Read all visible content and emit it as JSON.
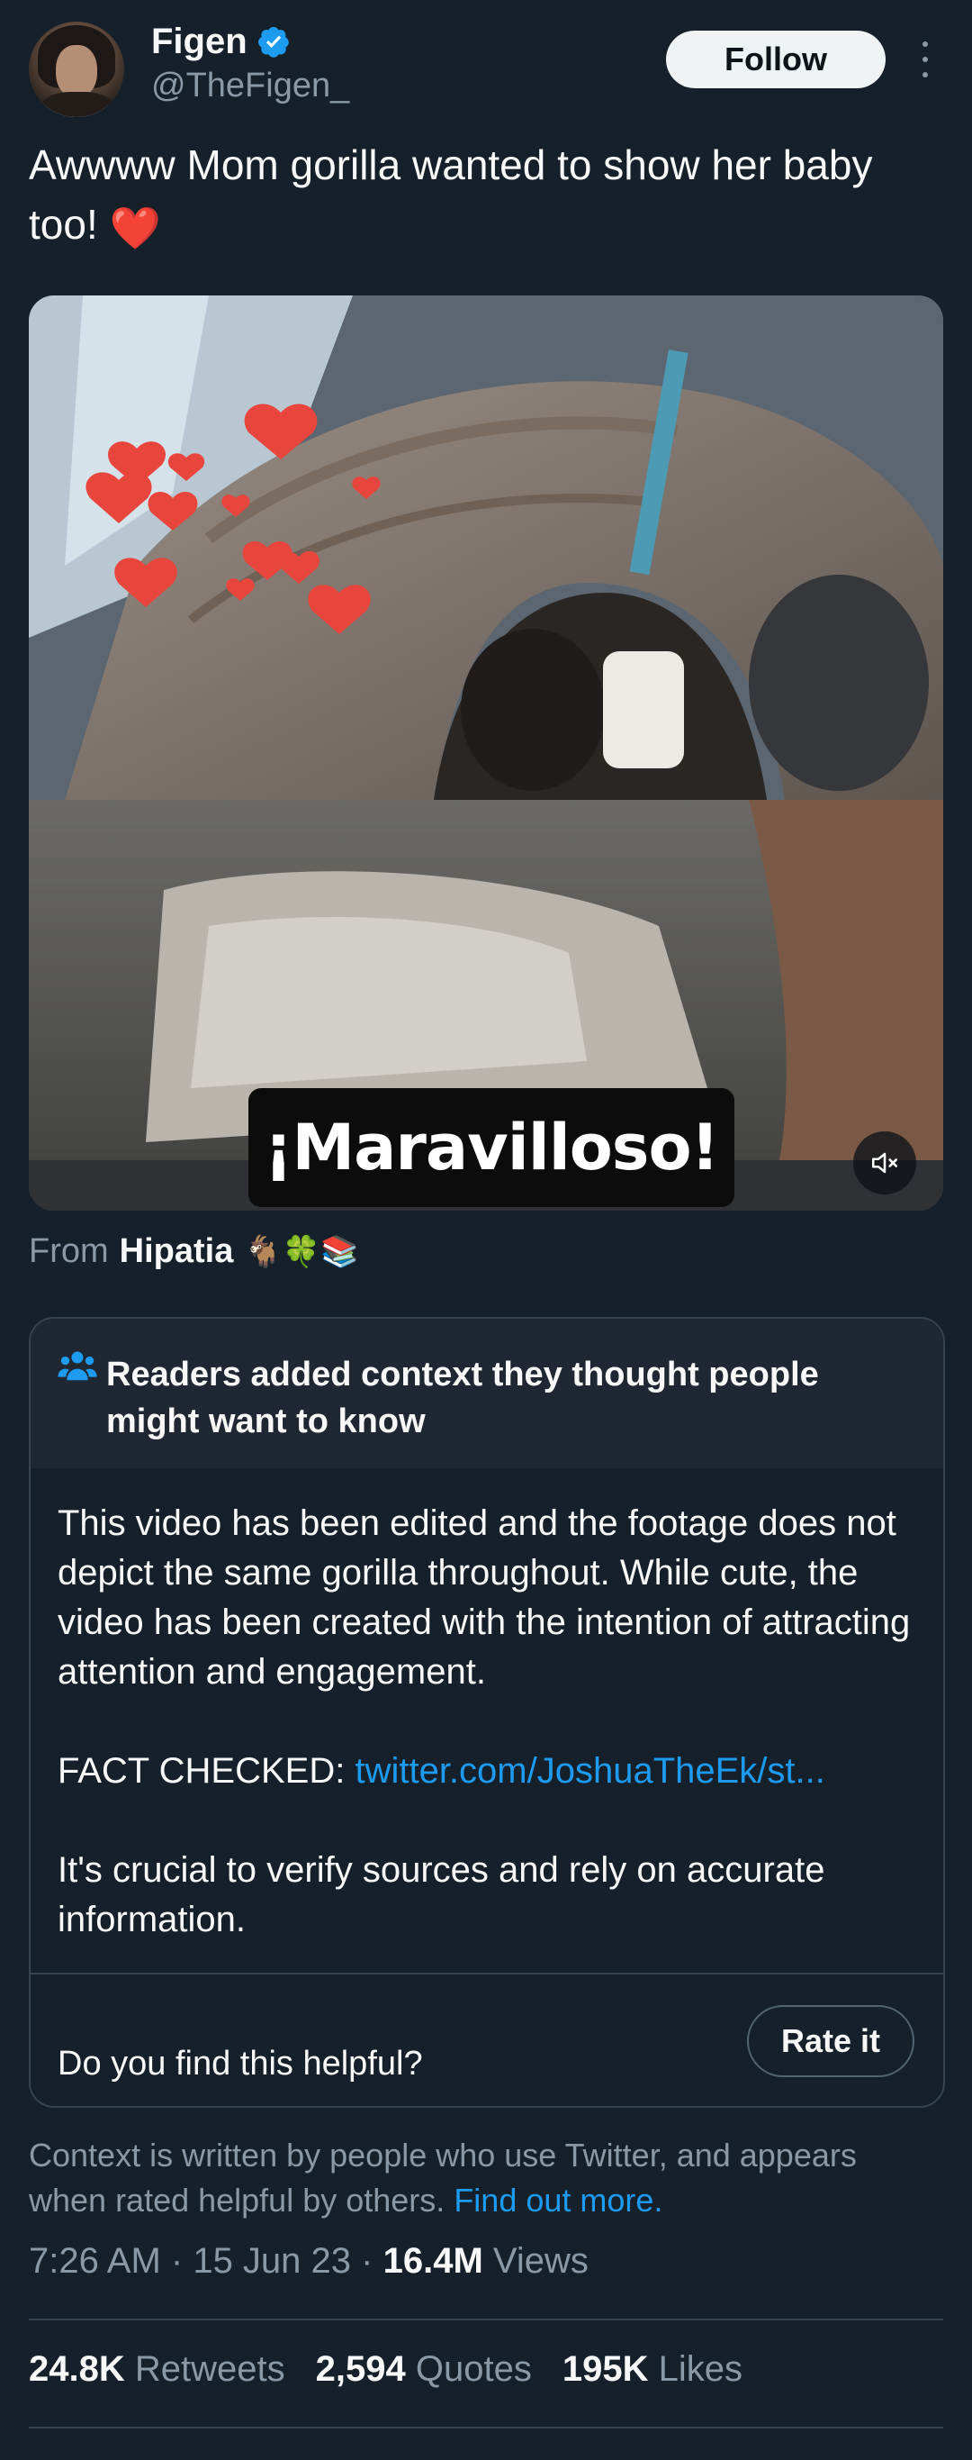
{
  "author": {
    "name": "Figen",
    "handle": "@TheFigen_",
    "verified_color": "#1d9bf0"
  },
  "header": {
    "follow_label": "Follow"
  },
  "tweet": {
    "text": "Awwww Mom gorilla wanted to show her baby too!",
    "emoji": "❤️"
  },
  "media": {
    "caption": "¡Maravilloso!",
    "mute_icon": "speaker-muted-icon"
  },
  "source": {
    "prefix": "From",
    "name": "Hipatia",
    "emojis": "🐐🍀📚"
  },
  "community_note": {
    "title": "Readers added context they thought people might want to know",
    "paragraph_1": "This video has been edited and the footage does not depict the same gorilla throughout. While cute, the video has been created with the intention of attracting attention and engagement.",
    "fact_checked_label": "FACT CHECKED:",
    "fact_checked_link": "twitter.com/JoshuaTheEk/st...",
    "paragraph_3": "It's crucial to verify sources and rely on accurate information.",
    "helpful_question": "Do you find this helpful?",
    "rate_label": "Rate it"
  },
  "context_footer": {
    "text": "Context is written by people who use Twitter, and appears when rated helpful by others.",
    "link": "Find out more."
  },
  "meta": {
    "time": "7:26 AM",
    "date": "15 Jun 23",
    "views_count": "16.4M",
    "views_label": "Views"
  },
  "stats": {
    "retweets_count": "24.8K",
    "retweets_label": "Retweets",
    "quotes_count": "2,594",
    "quotes_label": "Quotes",
    "likes_count": "195K",
    "likes_label": "Likes"
  },
  "colors": {
    "background": "#15202b",
    "accent": "#1d9bf0",
    "muted_text": "#8b98a5",
    "border": "#38444d"
  }
}
